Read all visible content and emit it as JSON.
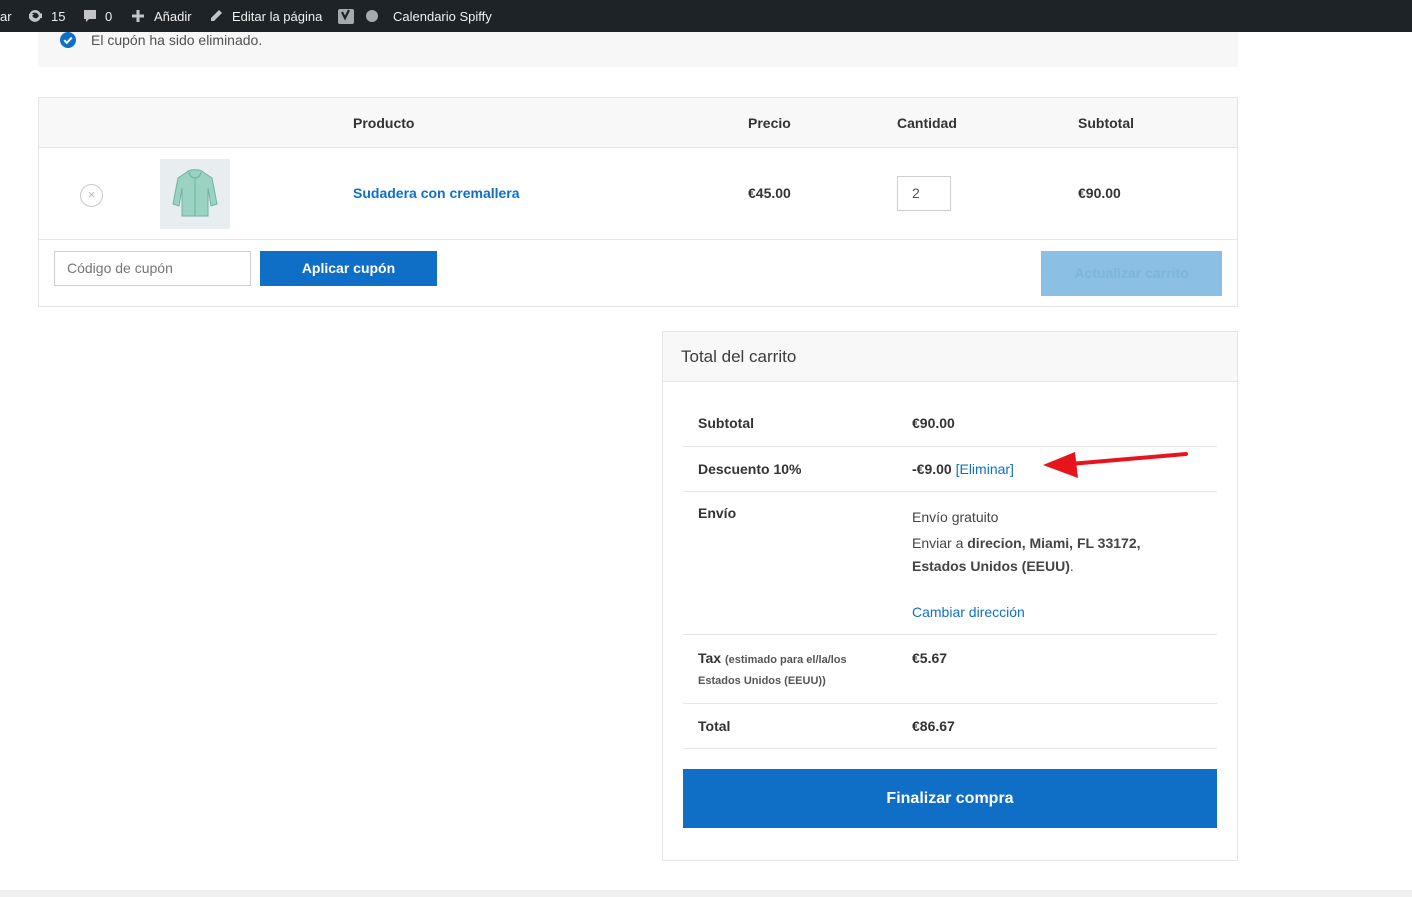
{
  "adminbar": {
    "cut_label": "ar",
    "updates_count": "15",
    "comments_count": "0",
    "add_label": "Añadir",
    "edit_label": "Editar la página",
    "calendar_label": "Calendario Spiffy"
  },
  "notice": {
    "text": "El cupón ha sido eliminado."
  },
  "cart": {
    "headers": {
      "product": "Producto",
      "price": "Precio",
      "quantity": "Cantidad",
      "subtotal": "Subtotal"
    },
    "item": {
      "remove": "×",
      "name": "Sudadera con cremallera",
      "price": "€45.00",
      "quantity": "2",
      "subtotal": "€90.00"
    },
    "coupon_placeholder": "Código de cupón",
    "apply_label": "Aplicar cupón",
    "update_label": "Actualizar carrito"
  },
  "totals": {
    "title": "Total del carrito",
    "subtotal_label": "Subtotal",
    "subtotal_value": "€90.00",
    "discount_label": "Descuento 10%",
    "discount_value": "-€9.00",
    "discount_remove": "[Eliminar]",
    "shipping_label": "Envío",
    "shipping_method": "Envío gratuito",
    "ship_to_prefix": "Enviar a ",
    "ship_to_address_1": "direcion, Miami, FL 33172,",
    "ship_to_address_2": "Estados Unidos (EEUU)",
    "ship_to_suffix": ".",
    "change_address": "Cambiar dirección",
    "tax_label": "Tax",
    "tax_note_1": "(estimado para el/la/los",
    "tax_note_2": "Estados Unidos (EEUU))",
    "tax_value": "€5.67",
    "total_label": "Total",
    "total_value": "€86.67",
    "checkout_label": "Finalizar compra"
  },
  "colors": {
    "accent": "#0f6fc6",
    "adminbar": "#1d2327",
    "annotation_arrow": "#e8141c"
  }
}
